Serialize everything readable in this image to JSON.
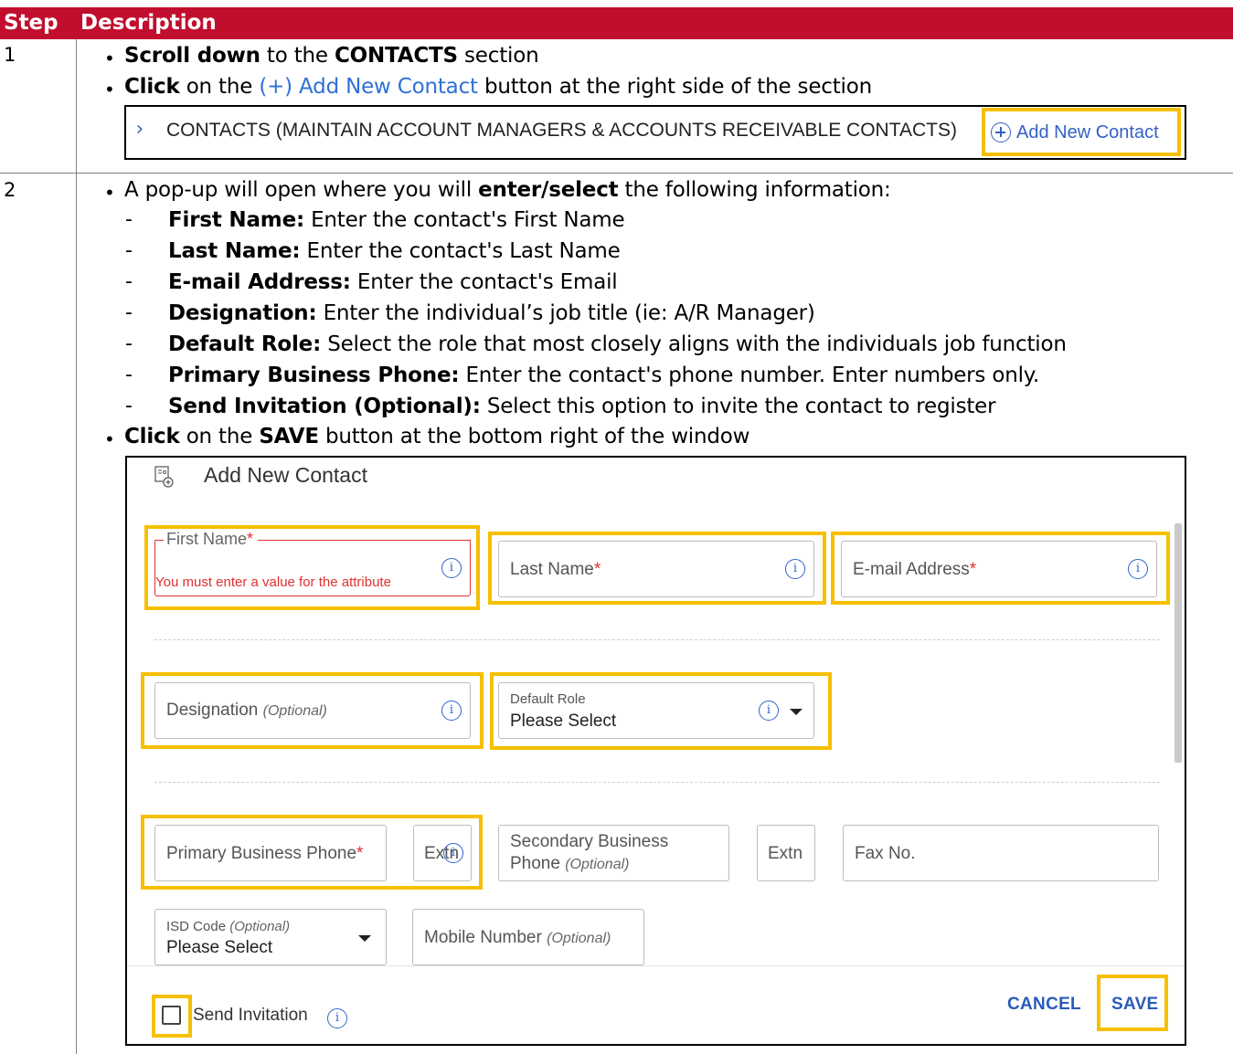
{
  "table": {
    "header_step": "Step",
    "header_description": "Description"
  },
  "step1": {
    "number": "1",
    "line1": {
      "bold1": "Scroll down",
      "text1": " to the ",
      "bold2": "CONTACTS",
      "text2": " section"
    },
    "line2": {
      "bold1": "Click",
      "text1": " on the ",
      "link": "(+) Add New Contact",
      "text2": " button at the right side of the section"
    },
    "strip": {
      "chevron": "›",
      "title": "CONTACTS (MAINTAIN ACCOUNT MANAGERS & ACCOUNTS RECEIVABLE CONTACTS)",
      "add_label": "Add New Contact"
    }
  },
  "step2": {
    "number": "2",
    "intro": {
      "text1": "A pop-up will open where you will ",
      "bold": "enter/select",
      "text2": " the following information:"
    },
    "fields": [
      {
        "label": "First Name:",
        "desc": " Enter the contact's First Name"
      },
      {
        "label": "Last Name:",
        "desc": " Enter the contact's Last Name"
      },
      {
        "label": "E-mail Address:",
        "desc": " Enter the contact's Email"
      },
      {
        "label": "Designation:",
        "desc": " Enter the individual’s job title (ie: A/R Manager)"
      },
      {
        "label": "Default Role:",
        "desc": " Select the role that most closely aligns with the individuals job function"
      },
      {
        "label": "Primary Business Phone:",
        "desc": " Enter the contact's phone number.  Enter numbers only."
      },
      {
        "label": "Send Invitation (Optional):",
        "desc": " Select this option to invite the contact to register"
      }
    ],
    "dash": "-",
    "bullet": "•",
    "final": {
      "bold1": "Click",
      "text1": " on the ",
      "bold2": "SAVE",
      "text2": " button at the bottom right of the window"
    }
  },
  "dialog": {
    "title": "Add New Contact",
    "first_name": {
      "label": "First Name",
      "required": "*",
      "error": "You must enter a value for the attribute"
    },
    "last_name": {
      "label": "Last Name",
      "required": "*"
    },
    "email": {
      "label": "E-mail Address",
      "required": "*"
    },
    "designation": {
      "label": "Designation",
      "optional": "(Optional)"
    },
    "default_role": {
      "label": "Default Role",
      "value": "Please Select"
    },
    "primary_phone": {
      "label": "Primary Business Phone",
      "required": "*",
      "extn": "Extn"
    },
    "secondary_phone": {
      "label_line1": "Secondary Business",
      "label_line2": "Phone",
      "optional": "(Optional)",
      "extn": "Extn"
    },
    "fax": {
      "label": "Fax No."
    },
    "isd": {
      "label": "ISD Code",
      "optional": "(Optional)",
      "value": "Please Select"
    },
    "mobile": {
      "label": "Mobile Number",
      "optional": "(Optional)"
    },
    "send_invitation": "Send Invitation",
    "cancel": "CANCEL",
    "save": "SAVE",
    "info_glyph": "i"
  },
  "colors": {
    "header_red": "#c10e2e",
    "highlight_yellow": "#f6bf00",
    "link_blue": "#2f6fd6",
    "error_red": "#e23030"
  }
}
